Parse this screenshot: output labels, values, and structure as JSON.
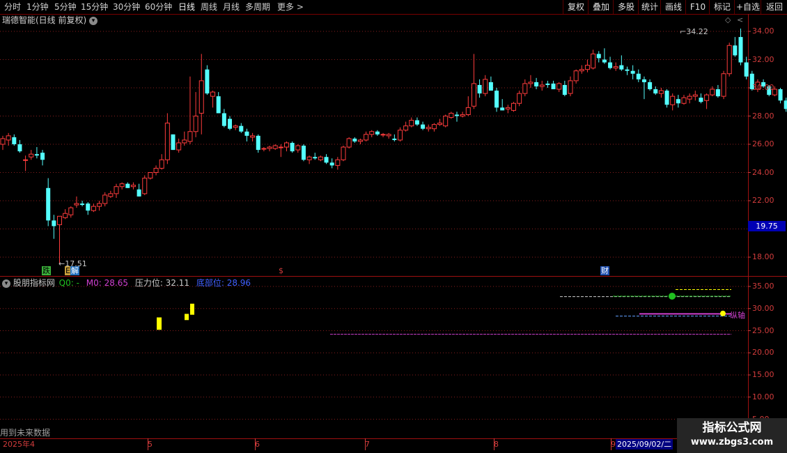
{
  "toolbar": {
    "periods": [
      "分时",
      "1分钟",
      "5分钟",
      "15分钟",
      "30分钟",
      "60分钟",
      "日线",
      "周线",
      "月线",
      "多周期",
      "更多"
    ],
    "active_period": "日线",
    "right_buttons": [
      "复权",
      "叠加",
      "多股",
      "统计",
      "画线",
      "F10",
      "标记",
      "+自选",
      "返回"
    ]
  },
  "stock": {
    "title": "瑞德智能(日线 前复权)"
  },
  "main_chart": {
    "y_ticks": [
      "34.00",
      "32.00",
      "30.00",
      "28.00",
      "26.00",
      "24.00",
      "22.00",
      "20.00",
      "18.00"
    ],
    "y_values": [
      34,
      32,
      30,
      28,
      26,
      24,
      22,
      20,
      18
    ],
    "last_price": "19.75",
    "high_label": "34.22",
    "low_label": "17.51",
    "markers": [
      {
        "text": "跌",
        "color": "#000000",
        "bg": "#3cb43c"
      },
      {
        "text": "E",
        "color": "#000000",
        "bg": "#c8a03c"
      },
      {
        "text": "解",
        "color": "#ffffff",
        "bg": "#2070c0"
      },
      {
        "text": "$",
        "color": "#d23c3c",
        "bg": "transparent"
      },
      {
        "text": "财",
        "color": "#ffffff",
        "bg": "#2050b0"
      }
    ]
  },
  "indicator": {
    "name": "股朋指标网",
    "q0_label": "Q0: -",
    "m0_label": "M0: 28.65",
    "pressure_label": "压力位: 32.11",
    "support_label": "底部位: 28.96",
    "axis_tag": "纵轴",
    "y_ticks": [
      "35.00",
      "30.00",
      "25.00",
      "20.00",
      "15.00",
      "10.00",
      "5.00"
    ],
    "y_values": [
      35,
      30,
      25,
      20,
      15,
      10,
      5
    ]
  },
  "x_axis": {
    "labels": [
      "2025年4",
      "5",
      "6",
      "7",
      "8",
      "9"
    ],
    "cursor_date": "2025/09/02/二"
  },
  "footnote": "用到未来数据",
  "watermark": {
    "line1": "指标公式网",
    "line2": "www.zbgs3.com"
  },
  "colors": {
    "up": "#ff3c3c",
    "down": "#54ffff",
    "axis": "#d23c3c",
    "grid": "#8a1e1e",
    "yellow": "#ffff00",
    "magenta": "#d040d0",
    "green": "#20c020"
  },
  "chart_data": {
    "type": "candlestick",
    "series": [
      {
        "o": 26.0,
        "h": 26.6,
        "l": 25.6,
        "c": 26.4
      },
      {
        "o": 26.3,
        "h": 26.8,
        "l": 25.9,
        "c": 26.6
      },
      {
        "o": 26.5,
        "h": 26.7,
        "l": 25.9,
        "c": 26.0
      },
      {
        "o": 26.0,
        "h": 26.3,
        "l": 25.4,
        "c": 25.5
      },
      {
        "o": 24.9,
        "h": 25.2,
        "l": 24.1,
        "c": 24.9
      },
      {
        "o": 25.1,
        "h": 25.6,
        "l": 24.9,
        "c": 25.3
      },
      {
        "o": 25.3,
        "h": 25.8,
        "l": 25.0,
        "c": 25.2
      },
      {
        "o": 25.4,
        "h": 25.6,
        "l": 24.5,
        "c": 24.9
      },
      {
        "o": 22.9,
        "h": 23.6,
        "l": 20.2,
        "c": 20.6
      },
      {
        "o": 20.6,
        "h": 21.0,
        "l": 19.3,
        "c": 20.2
      },
      {
        "o": 20.3,
        "h": 20.9,
        "l": 17.5,
        "c": 20.9
      },
      {
        "o": 20.8,
        "h": 21.4,
        "l": 20.7,
        "c": 21.1
      },
      {
        "o": 21.0,
        "h": 21.6,
        "l": 20.8,
        "c": 21.5
      },
      {
        "o": 21.7,
        "h": 22.3,
        "l": 21.5,
        "c": 21.8
      },
      {
        "o": 21.8,
        "h": 22.0,
        "l": 21.6,
        "c": 21.7
      },
      {
        "o": 21.8,
        "h": 21.9,
        "l": 21.0,
        "c": 21.3
      },
      {
        "o": 21.3,
        "h": 21.8,
        "l": 21.2,
        "c": 21.6
      },
      {
        "o": 21.6,
        "h": 22.0,
        "l": 21.3,
        "c": 21.8
      },
      {
        "o": 21.8,
        "h": 22.6,
        "l": 21.6,
        "c": 22.4
      },
      {
        "o": 22.3,
        "h": 22.7,
        "l": 22.2,
        "c": 22.5
      },
      {
        "o": 22.5,
        "h": 23.2,
        "l": 22.2,
        "c": 23.0
      },
      {
        "o": 23.0,
        "h": 23.3,
        "l": 22.8,
        "c": 23.2
      },
      {
        "o": 23.2,
        "h": 23.3,
        "l": 22.9,
        "c": 22.9
      },
      {
        "o": 23.0,
        "h": 23.3,
        "l": 22.8,
        "c": 23.1
      },
      {
        "o": 22.8,
        "h": 23.2,
        "l": 22.3,
        "c": 22.3
      },
      {
        "o": 22.5,
        "h": 23.8,
        "l": 22.4,
        "c": 23.6
      },
      {
        "o": 23.6,
        "h": 24.0,
        "l": 23.5,
        "c": 24.0
      },
      {
        "o": 24.0,
        "h": 24.5,
        "l": 23.8,
        "c": 24.3
      },
      {
        "o": 24.3,
        "h": 25.3,
        "l": 24.2,
        "c": 24.9
      },
      {
        "o": 24.9,
        "h": 28.2,
        "l": 24.6,
        "c": 27.5
      },
      {
        "o": 26.7,
        "h": 26.7,
        "l": 25.6,
        "c": 25.6
      },
      {
        "o": 25.6,
        "h": 26.4,
        "l": 25.4,
        "c": 26.1
      },
      {
        "o": 26.1,
        "h": 26.9,
        "l": 25.9,
        "c": 26.3
      },
      {
        "o": 26.2,
        "h": 30.8,
        "l": 26.0,
        "c": 26.9
      },
      {
        "o": 26.9,
        "h": 29.7,
        "l": 26.5,
        "c": 28.0
      },
      {
        "o": 28.2,
        "h": 32.4,
        "l": 26.7,
        "c": 30.5
      },
      {
        "o": 31.3,
        "h": 31.6,
        "l": 29.5,
        "c": 29.6
      },
      {
        "o": 29.4,
        "h": 29.8,
        "l": 28.6,
        "c": 29.7
      },
      {
        "o": 29.4,
        "h": 29.7,
        "l": 28.2,
        "c": 28.2
      },
      {
        "o": 28.2,
        "h": 28.5,
        "l": 27.2,
        "c": 27.3
      },
      {
        "o": 27.8,
        "h": 28.0,
        "l": 27.0,
        "c": 27.1
      },
      {
        "o": 27.2,
        "h": 27.4,
        "l": 27.0,
        "c": 27.3
      },
      {
        "o": 27.3,
        "h": 27.5,
        "l": 26.8,
        "c": 26.9
      },
      {
        "o": 26.9,
        "h": 27.1,
        "l": 26.2,
        "c": 26.6
      },
      {
        "o": 26.5,
        "h": 26.8,
        "l": 26.2,
        "c": 26.6
      },
      {
        "o": 26.6,
        "h": 26.7,
        "l": 25.4,
        "c": 25.6
      },
      {
        "o": 25.7,
        "h": 25.8,
        "l": 25.5,
        "c": 25.7
      },
      {
        "o": 25.7,
        "h": 25.9,
        "l": 25.5,
        "c": 25.8
      },
      {
        "o": 25.7,
        "h": 26.0,
        "l": 25.6,
        "c": 25.9
      },
      {
        "o": 25.8,
        "h": 26.0,
        "l": 25.1,
        "c": 25.8
      },
      {
        "o": 25.8,
        "h": 26.2,
        "l": 25.5,
        "c": 26.1
      },
      {
        "o": 26.1,
        "h": 26.2,
        "l": 25.4,
        "c": 25.5
      },
      {
        "o": 25.6,
        "h": 26.0,
        "l": 25.4,
        "c": 25.9
      },
      {
        "o": 25.9,
        "h": 26.0,
        "l": 24.8,
        "c": 24.9
      },
      {
        "o": 24.9,
        "h": 25.2,
        "l": 24.6,
        "c": 25.1
      },
      {
        "o": 25.1,
        "h": 25.4,
        "l": 24.9,
        "c": 25.0
      },
      {
        "o": 24.9,
        "h": 25.2,
        "l": 24.8,
        "c": 25.1
      },
      {
        "o": 25.1,
        "h": 25.3,
        "l": 24.6,
        "c": 24.7
      },
      {
        "o": 24.7,
        "h": 25.0,
        "l": 24.3,
        "c": 24.5
      },
      {
        "o": 24.5,
        "h": 25.1,
        "l": 24.2,
        "c": 24.9
      },
      {
        "o": 24.9,
        "h": 25.9,
        "l": 24.8,
        "c": 25.8
      },
      {
        "o": 25.8,
        "h": 26.5,
        "l": 25.7,
        "c": 26.4
      },
      {
        "o": 26.4,
        "h": 26.5,
        "l": 26.1,
        "c": 26.2
      },
      {
        "o": 26.2,
        "h": 26.4,
        "l": 26.0,
        "c": 26.3
      },
      {
        "o": 26.3,
        "h": 26.9,
        "l": 26.2,
        "c": 26.7
      },
      {
        "o": 26.7,
        "h": 27.0,
        "l": 26.5,
        "c": 26.9
      },
      {
        "o": 26.9,
        "h": 27.0,
        "l": 26.6,
        "c": 26.7
      },
      {
        "o": 26.7,
        "h": 26.8,
        "l": 26.5,
        "c": 26.7
      },
      {
        "o": 26.6,
        "h": 26.8,
        "l": 26.4,
        "c": 26.7
      },
      {
        "o": 26.4,
        "h": 26.7,
        "l": 26.2,
        "c": 26.3
      },
      {
        "o": 26.3,
        "h": 27.2,
        "l": 26.2,
        "c": 27.0
      },
      {
        "o": 27.0,
        "h": 27.6,
        "l": 26.9,
        "c": 27.3
      },
      {
        "o": 27.3,
        "h": 27.9,
        "l": 27.2,
        "c": 27.7
      },
      {
        "o": 27.7,
        "h": 27.9,
        "l": 27.3,
        "c": 27.4
      },
      {
        "o": 27.4,
        "h": 27.6,
        "l": 27.0,
        "c": 27.1
      },
      {
        "o": 27.1,
        "h": 27.4,
        "l": 26.9,
        "c": 27.2
      },
      {
        "o": 27.1,
        "h": 27.5,
        "l": 26.9,
        "c": 27.4
      },
      {
        "o": 27.4,
        "h": 27.8,
        "l": 27.3,
        "c": 27.5
      },
      {
        "o": 27.3,
        "h": 28.1,
        "l": 27.2,
        "c": 28.0
      },
      {
        "o": 27.9,
        "h": 28.3,
        "l": 27.8,
        "c": 28.2
      },
      {
        "o": 28.1,
        "h": 28.3,
        "l": 27.6,
        "c": 28.0
      },
      {
        "o": 28.0,
        "h": 28.3,
        "l": 27.9,
        "c": 28.1
      },
      {
        "o": 28.1,
        "h": 29.4,
        "l": 28.0,
        "c": 28.6
      },
      {
        "o": 28.7,
        "h": 32.4,
        "l": 28.5,
        "c": 30.3
      },
      {
        "o": 30.2,
        "h": 30.6,
        "l": 29.3,
        "c": 29.6
      },
      {
        "o": 29.6,
        "h": 30.9,
        "l": 29.4,
        "c": 30.6
      },
      {
        "o": 30.4,
        "h": 30.8,
        "l": 29.8,
        "c": 29.8
      },
      {
        "o": 29.8,
        "h": 30.0,
        "l": 28.3,
        "c": 28.6
      },
      {
        "o": 28.6,
        "h": 29.2,
        "l": 28.4,
        "c": 28.4
      },
      {
        "o": 28.5,
        "h": 28.8,
        "l": 28.2,
        "c": 28.6
      },
      {
        "o": 28.4,
        "h": 29.0,
        "l": 28.3,
        "c": 28.9
      },
      {
        "o": 28.9,
        "h": 29.8,
        "l": 28.7,
        "c": 29.6
      },
      {
        "o": 29.6,
        "h": 30.6,
        "l": 29.4,
        "c": 30.3
      },
      {
        "o": 30.3,
        "h": 30.9,
        "l": 30.0,
        "c": 30.4
      },
      {
        "o": 30.4,
        "h": 30.7,
        "l": 29.9,
        "c": 30.1
      },
      {
        "o": 30.1,
        "h": 30.5,
        "l": 29.8,
        "c": 30.2
      },
      {
        "o": 30.3,
        "h": 30.5,
        "l": 30.0,
        "c": 30.2
      },
      {
        "o": 30.3,
        "h": 30.5,
        "l": 29.9,
        "c": 29.9
      },
      {
        "o": 29.9,
        "h": 30.4,
        "l": 29.7,
        "c": 30.3
      },
      {
        "o": 30.2,
        "h": 30.5,
        "l": 29.4,
        "c": 29.5
      },
      {
        "o": 29.6,
        "h": 30.8,
        "l": 29.4,
        "c": 30.5
      },
      {
        "o": 30.5,
        "h": 31.3,
        "l": 30.3,
        "c": 31.2
      },
      {
        "o": 31.2,
        "h": 31.6,
        "l": 31.0,
        "c": 31.3
      },
      {
        "o": 31.3,
        "h": 32.0,
        "l": 31.1,
        "c": 31.6
      },
      {
        "o": 31.4,
        "h": 32.7,
        "l": 31.3,
        "c": 32.4
      },
      {
        "o": 32.4,
        "h": 32.6,
        "l": 31.8,
        "c": 32.1
      },
      {
        "o": 32.0,
        "h": 32.8,
        "l": 31.7,
        "c": 31.8
      },
      {
        "o": 31.8,
        "h": 32.2,
        "l": 31.3,
        "c": 31.4
      },
      {
        "o": 31.4,
        "h": 31.8,
        "l": 31.2,
        "c": 31.5
      },
      {
        "o": 31.6,
        "h": 32.3,
        "l": 31.2,
        "c": 31.3
      },
      {
        "o": 31.3,
        "h": 31.5,
        "l": 30.9,
        "c": 31.2
      },
      {
        "o": 31.2,
        "h": 31.6,
        "l": 30.6,
        "c": 31.0
      },
      {
        "o": 31.0,
        "h": 31.3,
        "l": 30.4,
        "c": 30.6
      },
      {
        "o": 30.6,
        "h": 30.8,
        "l": 29.2,
        "c": 30.4
      },
      {
        "o": 30.4,
        "h": 30.6,
        "l": 29.8,
        "c": 29.9
      },
      {
        "o": 29.9,
        "h": 30.1,
        "l": 29.5,
        "c": 29.6
      },
      {
        "o": 29.6,
        "h": 30.0,
        "l": 29.3,
        "c": 29.8
      },
      {
        "o": 29.8,
        "h": 29.9,
        "l": 28.6,
        "c": 28.8
      },
      {
        "o": 28.8,
        "h": 29.6,
        "l": 28.4,
        "c": 29.4
      },
      {
        "o": 29.2,
        "h": 29.5,
        "l": 28.6,
        "c": 28.9
      },
      {
        "o": 28.9,
        "h": 29.5,
        "l": 28.8,
        "c": 29.3
      },
      {
        "o": 29.2,
        "h": 29.6,
        "l": 28.9,
        "c": 29.4
      },
      {
        "o": 29.4,
        "h": 29.8,
        "l": 29.1,
        "c": 29.5
      },
      {
        "o": 29.3,
        "h": 29.6,
        "l": 28.9,
        "c": 29.0
      },
      {
        "o": 29.1,
        "h": 29.6,
        "l": 28.5,
        "c": 29.5
      },
      {
        "o": 29.5,
        "h": 30.1,
        "l": 29.4,
        "c": 29.9
      },
      {
        "o": 29.9,
        "h": 30.2,
        "l": 29.3,
        "c": 29.4
      },
      {
        "o": 29.4,
        "h": 31.2,
        "l": 29.2,
        "c": 31.0
      },
      {
        "o": 31.0,
        "h": 33.2,
        "l": 30.8,
        "c": 33.0
      },
      {
        "o": 33.0,
        "h": 33.6,
        "l": 32.2,
        "c": 32.3
      },
      {
        "o": 33.6,
        "h": 34.2,
        "l": 31.6,
        "c": 31.8
      },
      {
        "o": 31.8,
        "h": 32.2,
        "l": 30.6,
        "c": 30.8
      },
      {
        "o": 31.0,
        "h": 31.2,
        "l": 29.8,
        "c": 29.9
      },
      {
        "o": 29.9,
        "h": 30.6,
        "l": 29.7,
        "c": 30.4
      },
      {
        "o": 30.4,
        "h": 30.6,
        "l": 30.0,
        "c": 30.1
      },
      {
        "o": 30.1,
        "h": 30.2,
        "l": 29.4,
        "c": 29.5
      },
      {
        "o": 29.5,
        "h": 30.1,
        "l": 29.4,
        "c": 29.9
      },
      {
        "o": 29.9,
        "h": 30.0,
        "l": 28.9,
        "c": 29.1
      },
      {
        "o": 29.1,
        "h": 29.3,
        "l": 28.3,
        "c": 28.5
      },
      {
        "o": 28.6,
        "h": 29.0,
        "l": 28.5,
        "c": 28.7
      },
      {
        "o": 28.7,
        "h": 28.9,
        "l": 28.3,
        "c": 28.4
      }
    ],
    "ylim": [
      17,
      35
    ]
  }
}
